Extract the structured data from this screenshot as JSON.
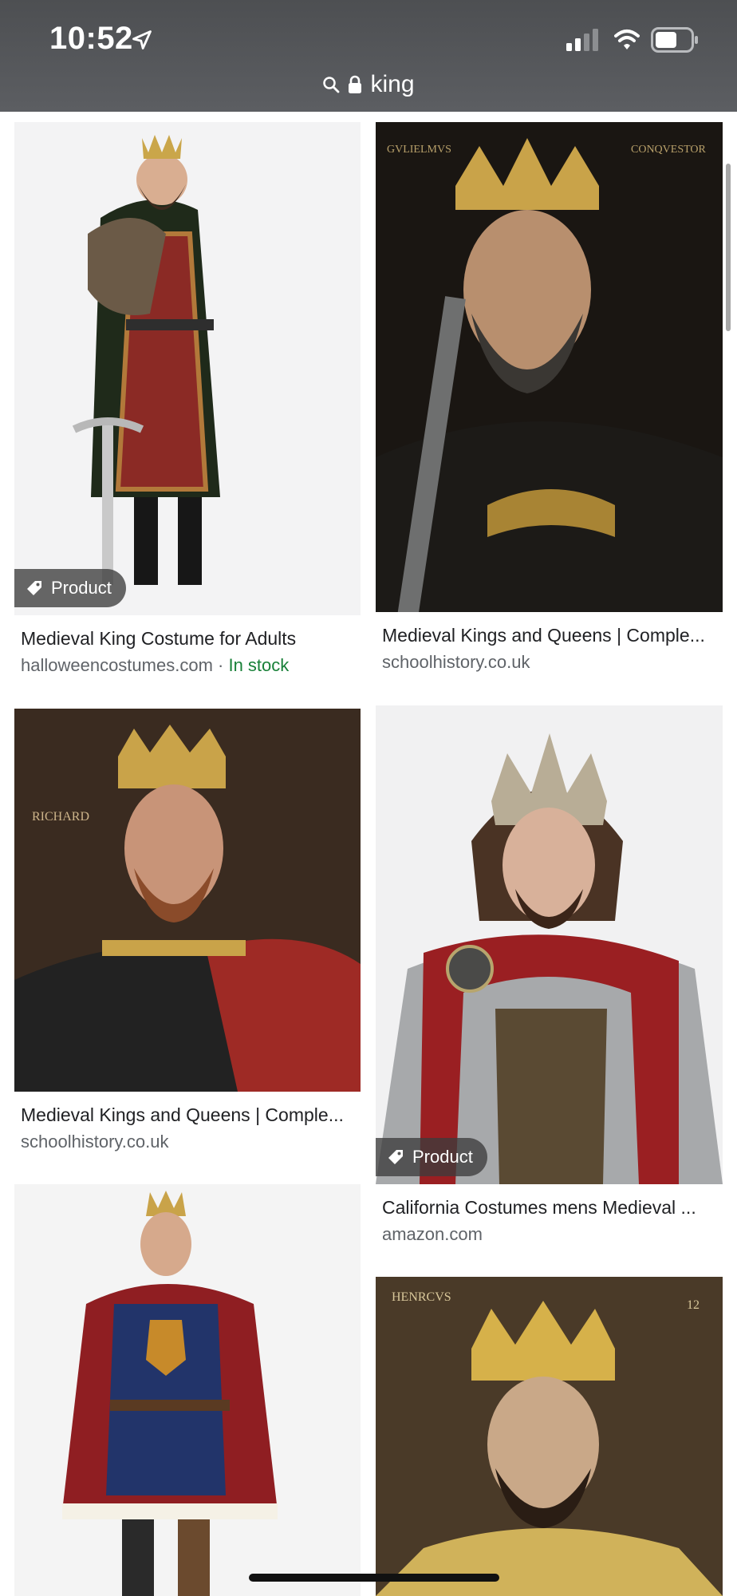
{
  "status_bar": {
    "time": "10:52",
    "icons": [
      "location-arrow-icon",
      "cellular-signal-icon",
      "wifi-icon",
      "battery-icon"
    ]
  },
  "address_bar": {
    "query": "king",
    "icons": [
      "search-icon",
      "lock-icon"
    ]
  },
  "results": [
    {
      "title": "Medieval King Costume for Adults",
      "source": "halloweencostumes.com",
      "separator": " · ",
      "stock": "In stock",
      "badge": "Product",
      "image_subject": "man in medieval king costume with crown, fur cape and sword"
    },
    {
      "title": "Medieval Kings and Queens | Comple...",
      "source": "schoolhistory.co.uk",
      "image_subject": "painted portrait of a crowned king holding a sword"
    },
    {
      "title": "Medieval Kings and Queens | Comple...",
      "source": "schoolhistory.co.uk",
      "image_subject": "painted portrait of Richard with crown and red sash"
    },
    {
      "title": "California Costumes mens Medieval ...",
      "source": "amazon.com",
      "badge": "Product",
      "image_subject": "man in medieval king costume with crown and red cape"
    },
    {
      "title": "",
      "source": "",
      "image_subject": "man in royal costume with crown and ermine cape"
    },
    {
      "title": "",
      "source": "",
      "image_subject": "painted portrait of crowned king Henry"
    }
  ],
  "image_inscriptions": {
    "card2_left": "GVLIELMVS",
    "card2_right": "CONQVESTOR",
    "card3": "RICHARD",
    "card6_left": "HENRCVS",
    "card6_right": "12"
  },
  "colors": {
    "topbar": "#55575a",
    "text_primary": "#202124",
    "text_secondary": "#5f6368",
    "in_stock": "#188038",
    "badge_bg": "rgba(60,60,60,0.78)"
  }
}
